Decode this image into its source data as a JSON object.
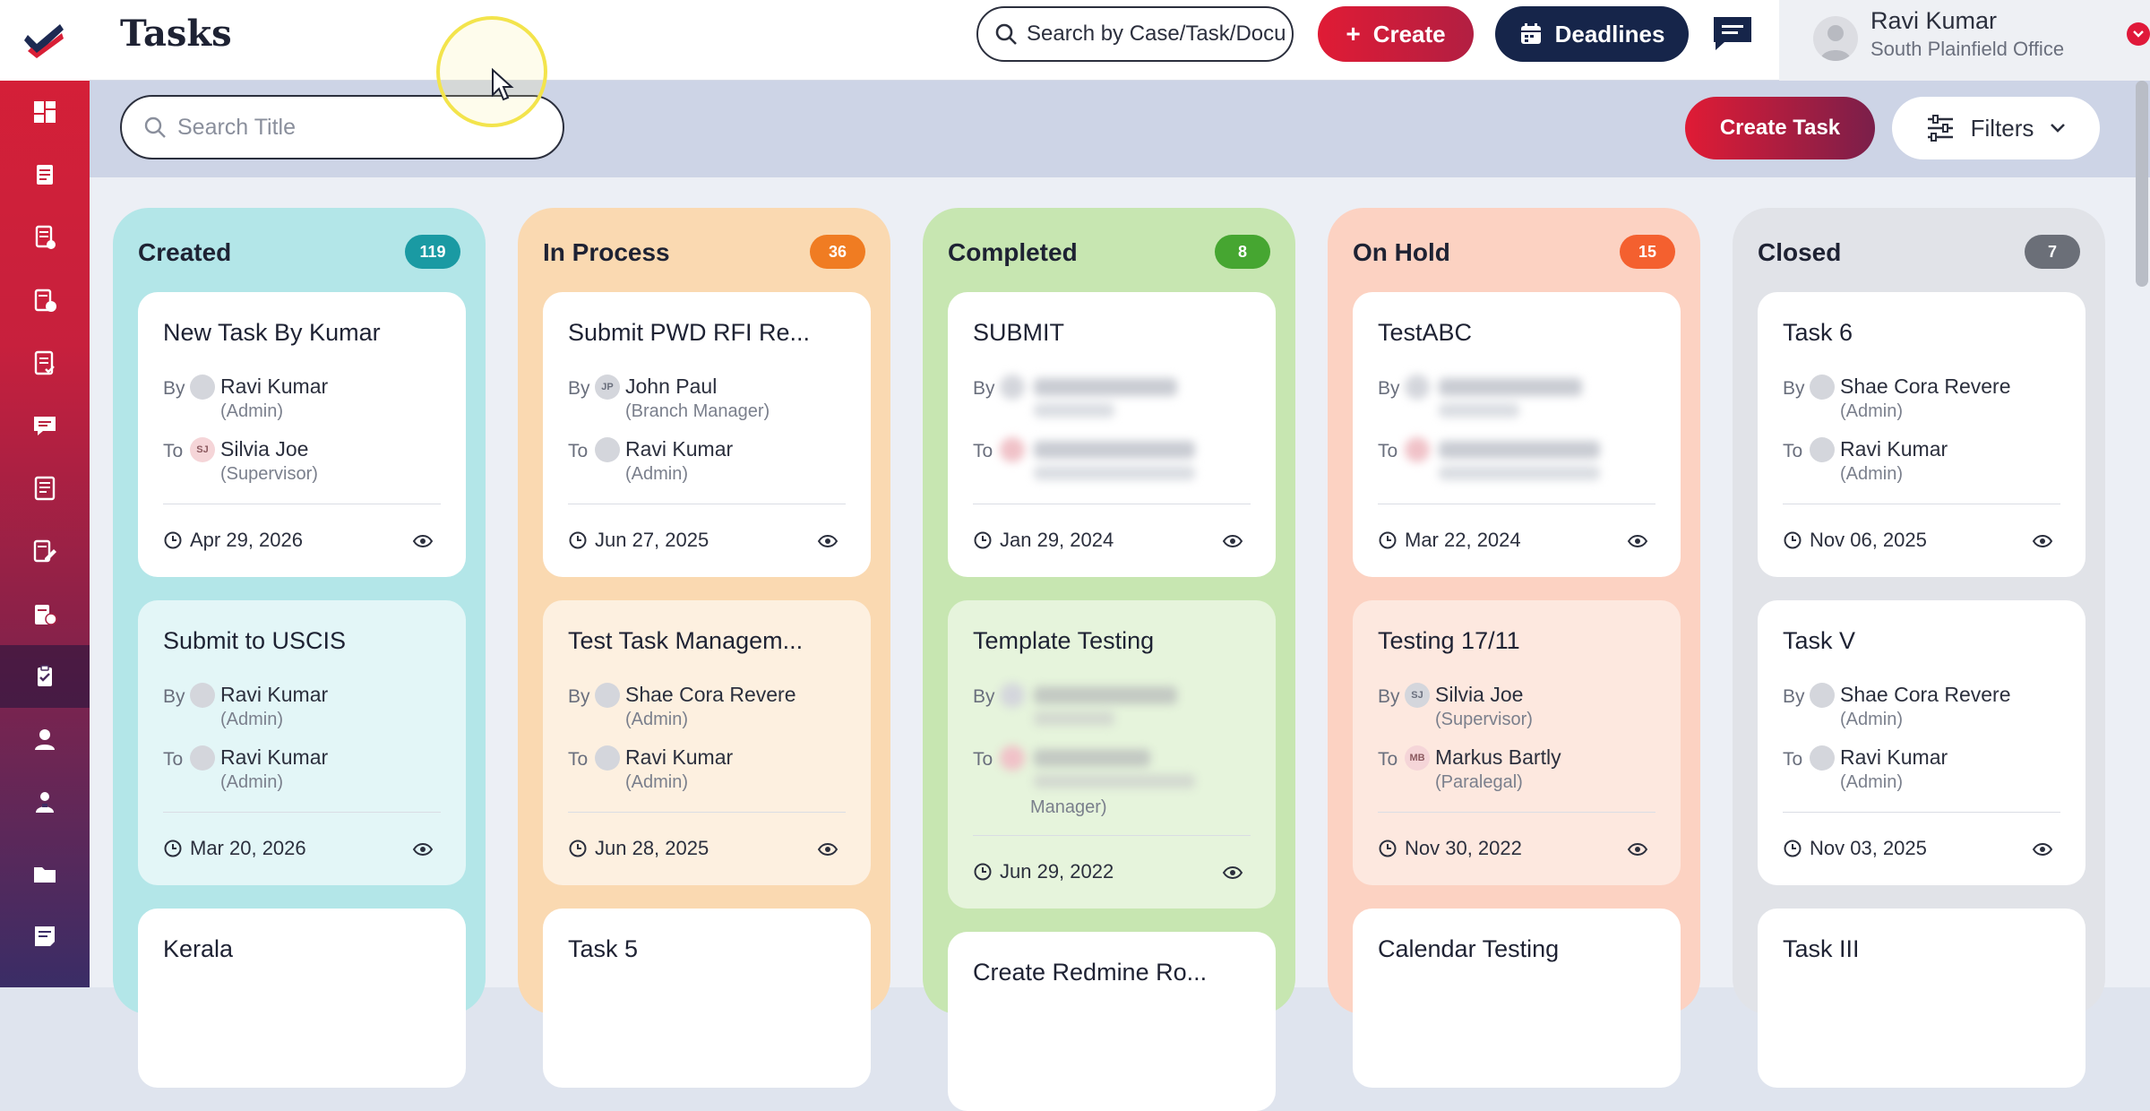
{
  "header": {
    "title": "Tasks",
    "search_placeholder": "Search by Case/Task/Document",
    "create_label": "Create",
    "deadlines_label": "Deadlines",
    "user": {
      "name": "Ravi Kumar",
      "office": "South Plainfield Office"
    }
  },
  "toolbar": {
    "title_search_placeholder": "Search Title",
    "create_task_label": "Create Task",
    "filters_label": "Filters"
  },
  "sidebar": {
    "icons": [
      "dashboard-icon",
      "documents-icon",
      "forms-icon",
      "case-icon",
      "checklist-icon",
      "messages-icon",
      "reports-icon",
      "edit-icon",
      "billing-icon",
      "tasks-icon",
      "user-icon",
      "contacts-icon",
      "folder-icon",
      "notes-icon"
    ]
  },
  "colors": {
    "created_bg": "#b3e6e8",
    "created_badge": "#1a9aa3",
    "inprocess_bg": "#fad9b1",
    "inprocess_badge": "#f07c22",
    "completed_bg": "#c7e6b1",
    "completed_badge": "#46a631",
    "onhold_bg": "#fcd2c2",
    "onhold_badge": "#f4602f",
    "closed_bg": "#e1e3e8",
    "closed_badge": "#6b6f78"
  },
  "columns": [
    {
      "title": "Created",
      "count": "119",
      "cards": [
        {
          "title": "New Task By Kumar",
          "by_label": "By",
          "to_label": "To",
          "by_name": "Ravi Kumar",
          "by_role": "(Admin)",
          "to_initials": "SJ",
          "to_name": "Silvia Joe",
          "to_role": "(Supervisor)",
          "date": "Apr 29, 2026"
        },
        {
          "title": "Submit to USCIS",
          "by_label": "By",
          "to_label": "To",
          "by_name": "Ravi Kumar",
          "by_role": "(Admin)",
          "to_name": "Ravi Kumar",
          "to_role": "(Admin)",
          "date": "Mar 20, 2026"
        },
        {
          "title": "Kerala"
        }
      ]
    },
    {
      "title": "In Process",
      "count": "36",
      "cards": [
        {
          "title": "Submit PWD RFI Re...",
          "by_label": "By",
          "to_label": "To",
          "by_initials": "JP",
          "by_name": "John Paul",
          "by_role": "(Branch Manager)",
          "to_name": "Ravi Kumar",
          "to_role": "(Admin)",
          "date": "Jun 27, 2025"
        },
        {
          "title": "Test Task Managem...",
          "by_label": "By",
          "to_label": "To",
          "by_name": "Shae Cora Revere",
          "by_role": "(Admin)",
          "to_name": "Ravi Kumar",
          "to_role": "(Admin)",
          "date": "Jun 28, 2025"
        },
        {
          "title": "Task 5"
        }
      ]
    },
    {
      "title": "Completed",
      "count": "8",
      "cards": [
        {
          "title": "SUBMIT",
          "by_label": "By",
          "to_label": "To",
          "date": "Jan 29, 2024"
        },
        {
          "title": "Template Testing",
          "by_label": "By",
          "to_label": "To",
          "to_role_tail": "Manager)",
          "date": "Jun 29, 2022"
        },
        {
          "title": "Create Redmine Ro..."
        }
      ]
    },
    {
      "title": "On Hold",
      "count": "15",
      "cards": [
        {
          "title": "TestABC",
          "by_label": "By",
          "to_label": "To",
          "date": "Mar 22, 2024"
        },
        {
          "title": "Testing 17/11",
          "by_label": "By",
          "to_label": "To",
          "by_initials": "SJ",
          "by_name": "Silvia Joe",
          "by_role": "(Supervisor)",
          "to_initials": "MB",
          "to_name": "Markus Bartly",
          "to_role": "(Paralegal)",
          "date": "Nov 30, 2022"
        },
        {
          "title": "Calendar Testing"
        }
      ]
    },
    {
      "title": "Closed",
      "count": "7",
      "cards": [
        {
          "title": "Task 6",
          "by_label": "By",
          "to_label": "To",
          "by_name": "Shae Cora Revere",
          "by_role": "(Admin)",
          "to_name": "Ravi Kumar",
          "to_role": "(Admin)",
          "date": "Nov 06, 2025"
        },
        {
          "title": "Task V",
          "by_label": "By",
          "to_label": "To",
          "by_name": "Shae Cora Revere",
          "by_role": "(Admin)",
          "to_name": "Ravi Kumar",
          "to_role": "(Admin)",
          "date": "Nov 03, 2025"
        },
        {
          "title": "Task III"
        }
      ]
    }
  ]
}
